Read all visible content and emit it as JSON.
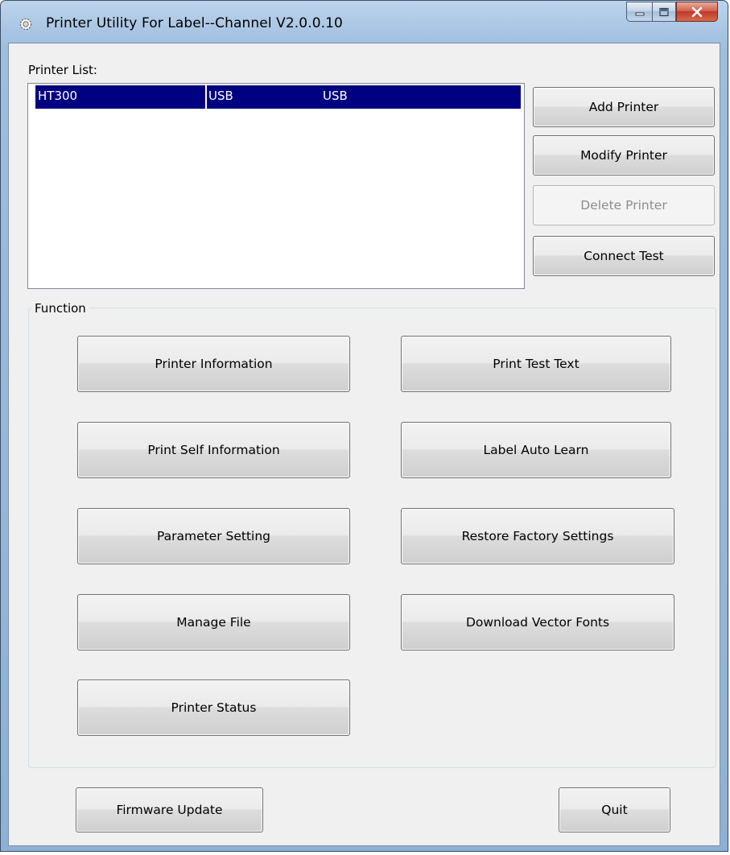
{
  "window": {
    "title": "Printer Utility For Label--Channel  V2.0.0.10"
  },
  "printer_list": {
    "label": "Printer List:",
    "rows": [
      {
        "name": "HT300",
        "port": "USB",
        "type": "USB"
      }
    ]
  },
  "side_buttons": {
    "add": "Add Printer",
    "modify": "Modify Printer",
    "delete": "Delete Printer",
    "connect": "Connect Test"
  },
  "function": {
    "title": "Function",
    "printer_information": "Printer Information",
    "print_test_text": "Print Test Text",
    "print_self_information": "Print Self Information",
    "label_auto_learn": "Label Auto Learn",
    "parameter_setting": "Parameter Setting",
    "restore_factory_settings": "Restore Factory Settings",
    "manage_file": "Manage File",
    "download_vector_fonts": "Download Vector Fonts",
    "printer_status": "Printer Status"
  },
  "footer": {
    "firmware_update": "Firmware Update",
    "quit": "Quit"
  }
}
